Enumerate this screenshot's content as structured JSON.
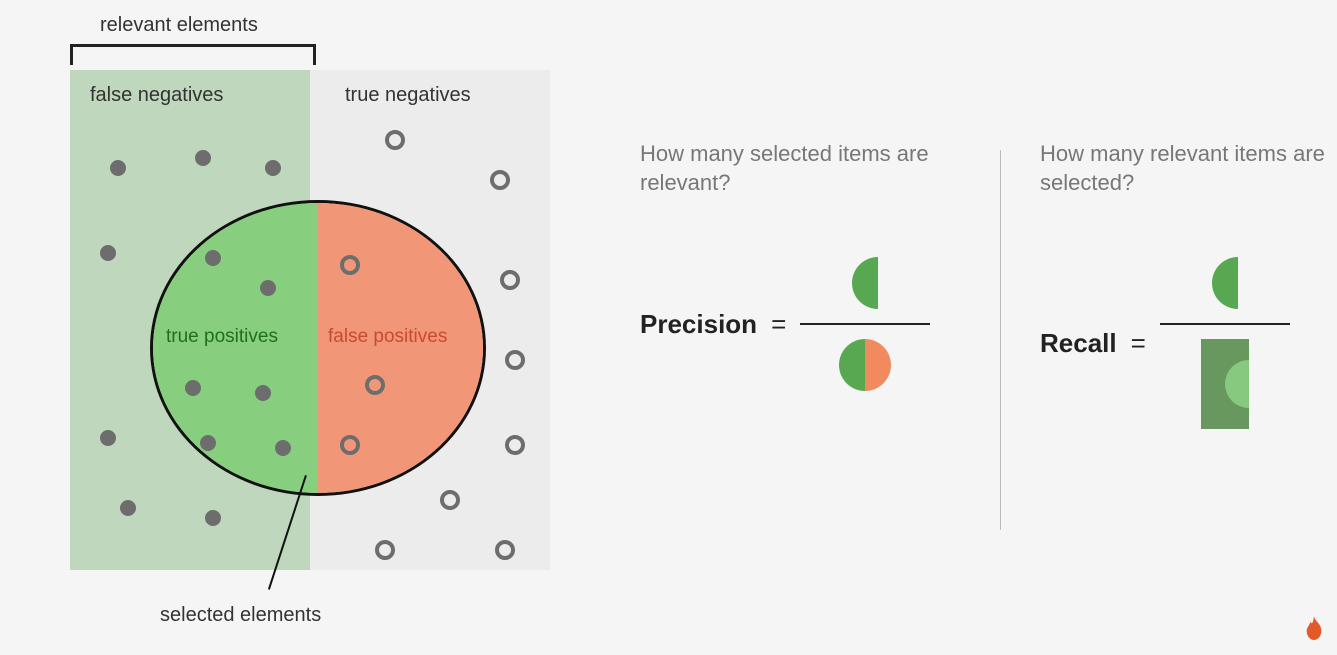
{
  "diagram": {
    "relevant_label": "relevant elements",
    "selected_label": "selected elements",
    "regions": {
      "false_negatives": "false negatives",
      "true_negatives": "true negatives",
      "true_positives": "true positives",
      "false_positives": "false positives"
    },
    "colors": {
      "relevant_bg": "#bfd7bc",
      "irrelevant_bg": "#ececec",
      "tp_fill": "#87cf7f",
      "fp_fill": "#f19778",
      "dot_solid": "#6d6d6d"
    }
  },
  "formulas": {
    "precision": {
      "question": "How many selected items are relevant?",
      "label": "Precision",
      "equals": "=",
      "numerator": "true_positives_half",
      "denominator": "true_positives_half + false_positives_half"
    },
    "recall": {
      "question": "How many relevant items are selected?",
      "label": "Recall",
      "equals": "=",
      "numerator": "true_positives_half",
      "denominator": "relevant_elements_rect"
    }
  },
  "chart_data": {
    "type": "venn_confusion",
    "description": "Precision/Recall explanatory diagram",
    "sets": {
      "relevant_elements": [
        "true_positives",
        "false_negatives"
      ],
      "selected_elements": [
        "true_positives",
        "false_positives"
      ],
      "irrelevant_elements": [
        "false_positives",
        "true_negatives"
      ]
    },
    "formulas": {
      "precision": "true_positives / (true_positives + false_positives)",
      "recall": "true_positives / (true_positives + false_negatives)"
    },
    "approx_dot_counts": {
      "false_negatives": 6,
      "true_positives": 6,
      "false_positives": 3,
      "true_negatives": 8
    }
  }
}
